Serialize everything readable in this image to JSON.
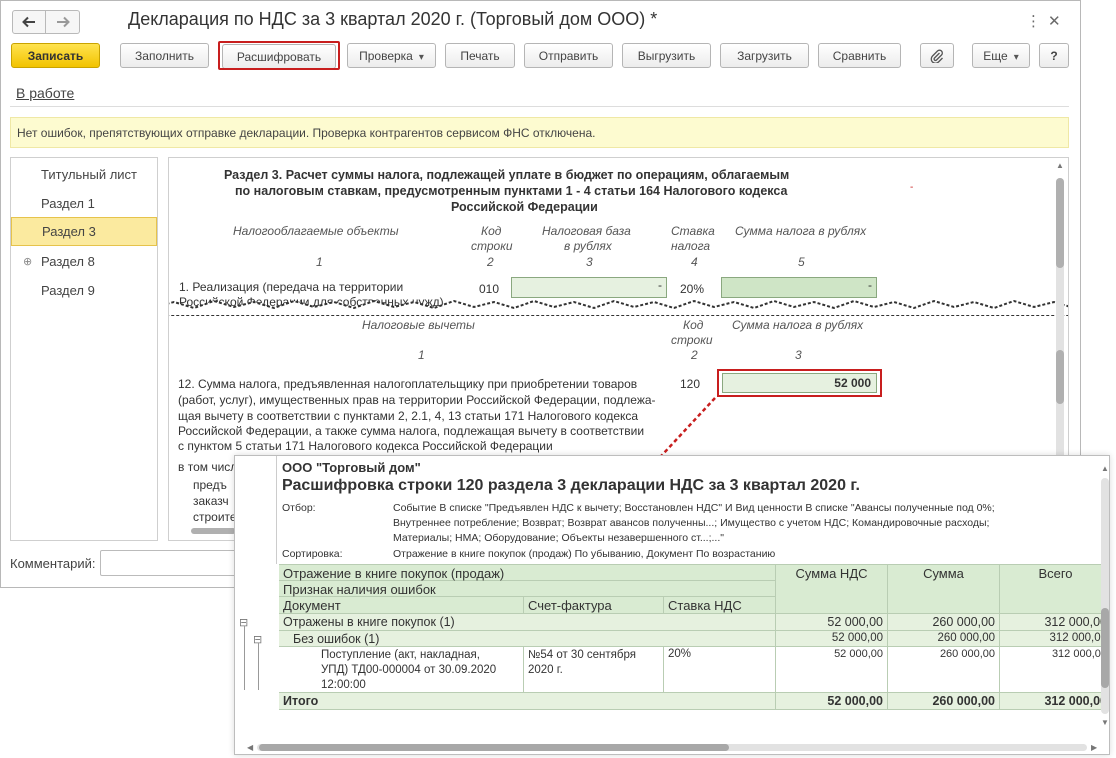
{
  "window": {
    "title": "Декларация по НДС за 3 квартал 2020 г. (Торговый дом ООО) *",
    "back_icon": "arrow-left-icon",
    "forward_icon": "arrow-right-icon"
  },
  "toolbar": {
    "save": "Записать",
    "fill": "Заполнить",
    "decode": "Расшифровать",
    "check": "Проверка",
    "print": "Печать",
    "send": "Отправить",
    "export": "Выгрузить",
    "import": "Загрузить",
    "compare": "Сравнить",
    "more": "Еще",
    "help": "?"
  },
  "status_link": "В работе",
  "message": "Нет ошибок, препятствующих отправке декларации. Проверка контрагентов сервисом ФНС отключена.",
  "sidebar": {
    "items": [
      {
        "label": "Титульный лист"
      },
      {
        "label": "Раздел 1"
      },
      {
        "label": "Раздел 3"
      },
      {
        "label": "Раздел 8"
      },
      {
        "label": "Раздел 9"
      }
    ]
  },
  "section": {
    "title1": "Раздел 3. Расчет суммы налога, подлежащей уплате в бюджет по операциям, облагаемым",
    "title2": "по налоговым ставкам, предусмотренным пунктами 1 - 4 статьи 164 Налогового кодекса",
    "title3": "Российской Федерации",
    "col_objects": "Налогооблагаемые объекты",
    "col_code1": "Код",
    "col_code2": "строки",
    "col_base1": "Налоговая база",
    "col_base2": "в рублях",
    "col_rate1": "Ставка",
    "col_rate2": "налога",
    "col_sum": "Сумма налога в рублях",
    "n1": "1",
    "n2": "2",
    "n3": "3",
    "n4": "4",
    "n5": "5",
    "row1_text1": "1. Реализация (передача на территории",
    "row1_text2": "Российской Федерации для собственных нужд)",
    "row1_code": "010",
    "row1_base": "-",
    "row1_rate": "20%",
    "row1_sum": "-",
    "ded_title": "Налоговые вычеты",
    "ded_code1": "Код",
    "ded_code2": "строки",
    "ded_sum": "Сумма налога в рублях",
    "d1": "1",
    "d2": "2",
    "d3": "3",
    "row12_lines": [
      "12. Сумма налога, предъявленная налогоплательщику при приобретении товаров",
      "(работ, услуг), имущественных прав на территории Российской Федерации, подлежа-",
      "щая вычету в соответствии с пунктами 2, 2.1, 4, 13 статьи 171 Налогового кодекса",
      "Российской Федерации, а также сумма налога, подлежащая вычету в соответствии",
      "с пунктом 5 статьи 171 Налогового кодекса Российской Федерации"
    ],
    "row12_code": "120",
    "row12_value": "52 000",
    "incl": "в том числ",
    "frag1": "предъ",
    "frag2": "заказч",
    "frag3": "строите"
  },
  "comment_label": "Комментарий:",
  "report": {
    "org": "ООО \"Торговый дом\"",
    "title": "Расшифровка строки 120 раздела 3 декларации НДС за 3 квартал 2020 г.",
    "filter_label": "Отбор:",
    "filter_lines": [
      "Событие В списке \"Предъявлен НДС к вычету; Восстановлен НДС\" И Вид ценности В списке \"Авансы полученные под 0%;",
      "Внутреннее потребление; Возврат; Возврат авансов полученны...; Имущество с учетом НДС; Командировочные расходы;",
      "Материалы; НМА; Оборудование; Объекты незавершенного ст...;...\""
    ],
    "sort_label": "Сортировка:",
    "sort_value": "Отражение в книге покупок (продаж) По убыванию, Документ По возрастанию",
    "h_reflection": "Отражение в книге покупок (продаж)",
    "h_error": "Признак наличия ошибок",
    "h_document": "Документ",
    "h_invoice": "Счет-фактура",
    "h_rate": "Ставка НДС",
    "h_vat": "Сумма НДС",
    "h_sum": "Сумма",
    "h_total": "Всего",
    "g1_label": "Отражены в книге покупок (1)",
    "g1_vat": "52 000,00",
    "g1_sum": "260 000,00",
    "g1_total": "312 000,00",
    "g2_label": "Без ошибок (1)",
    "g2_vat": "52 000,00",
    "g2_sum": "260 000,00",
    "g2_total": "312 000,00",
    "doc_lines": [
      "Поступление (акт, накладная,",
      "УПД) ТД00-000004 от 30.09.2020",
      "12:00:00"
    ],
    "inv_lines": [
      "№54 от 30 сентября",
      "2020 г."
    ],
    "doc_rate": "20%",
    "doc_vat": "52 000,00",
    "doc_sum": "260 000,00",
    "doc_total": "312 000,00",
    "total_label": "Итого",
    "total_vat": "52 000,00",
    "total_sum": "260 000,00",
    "total_total": "312 000,00"
  }
}
